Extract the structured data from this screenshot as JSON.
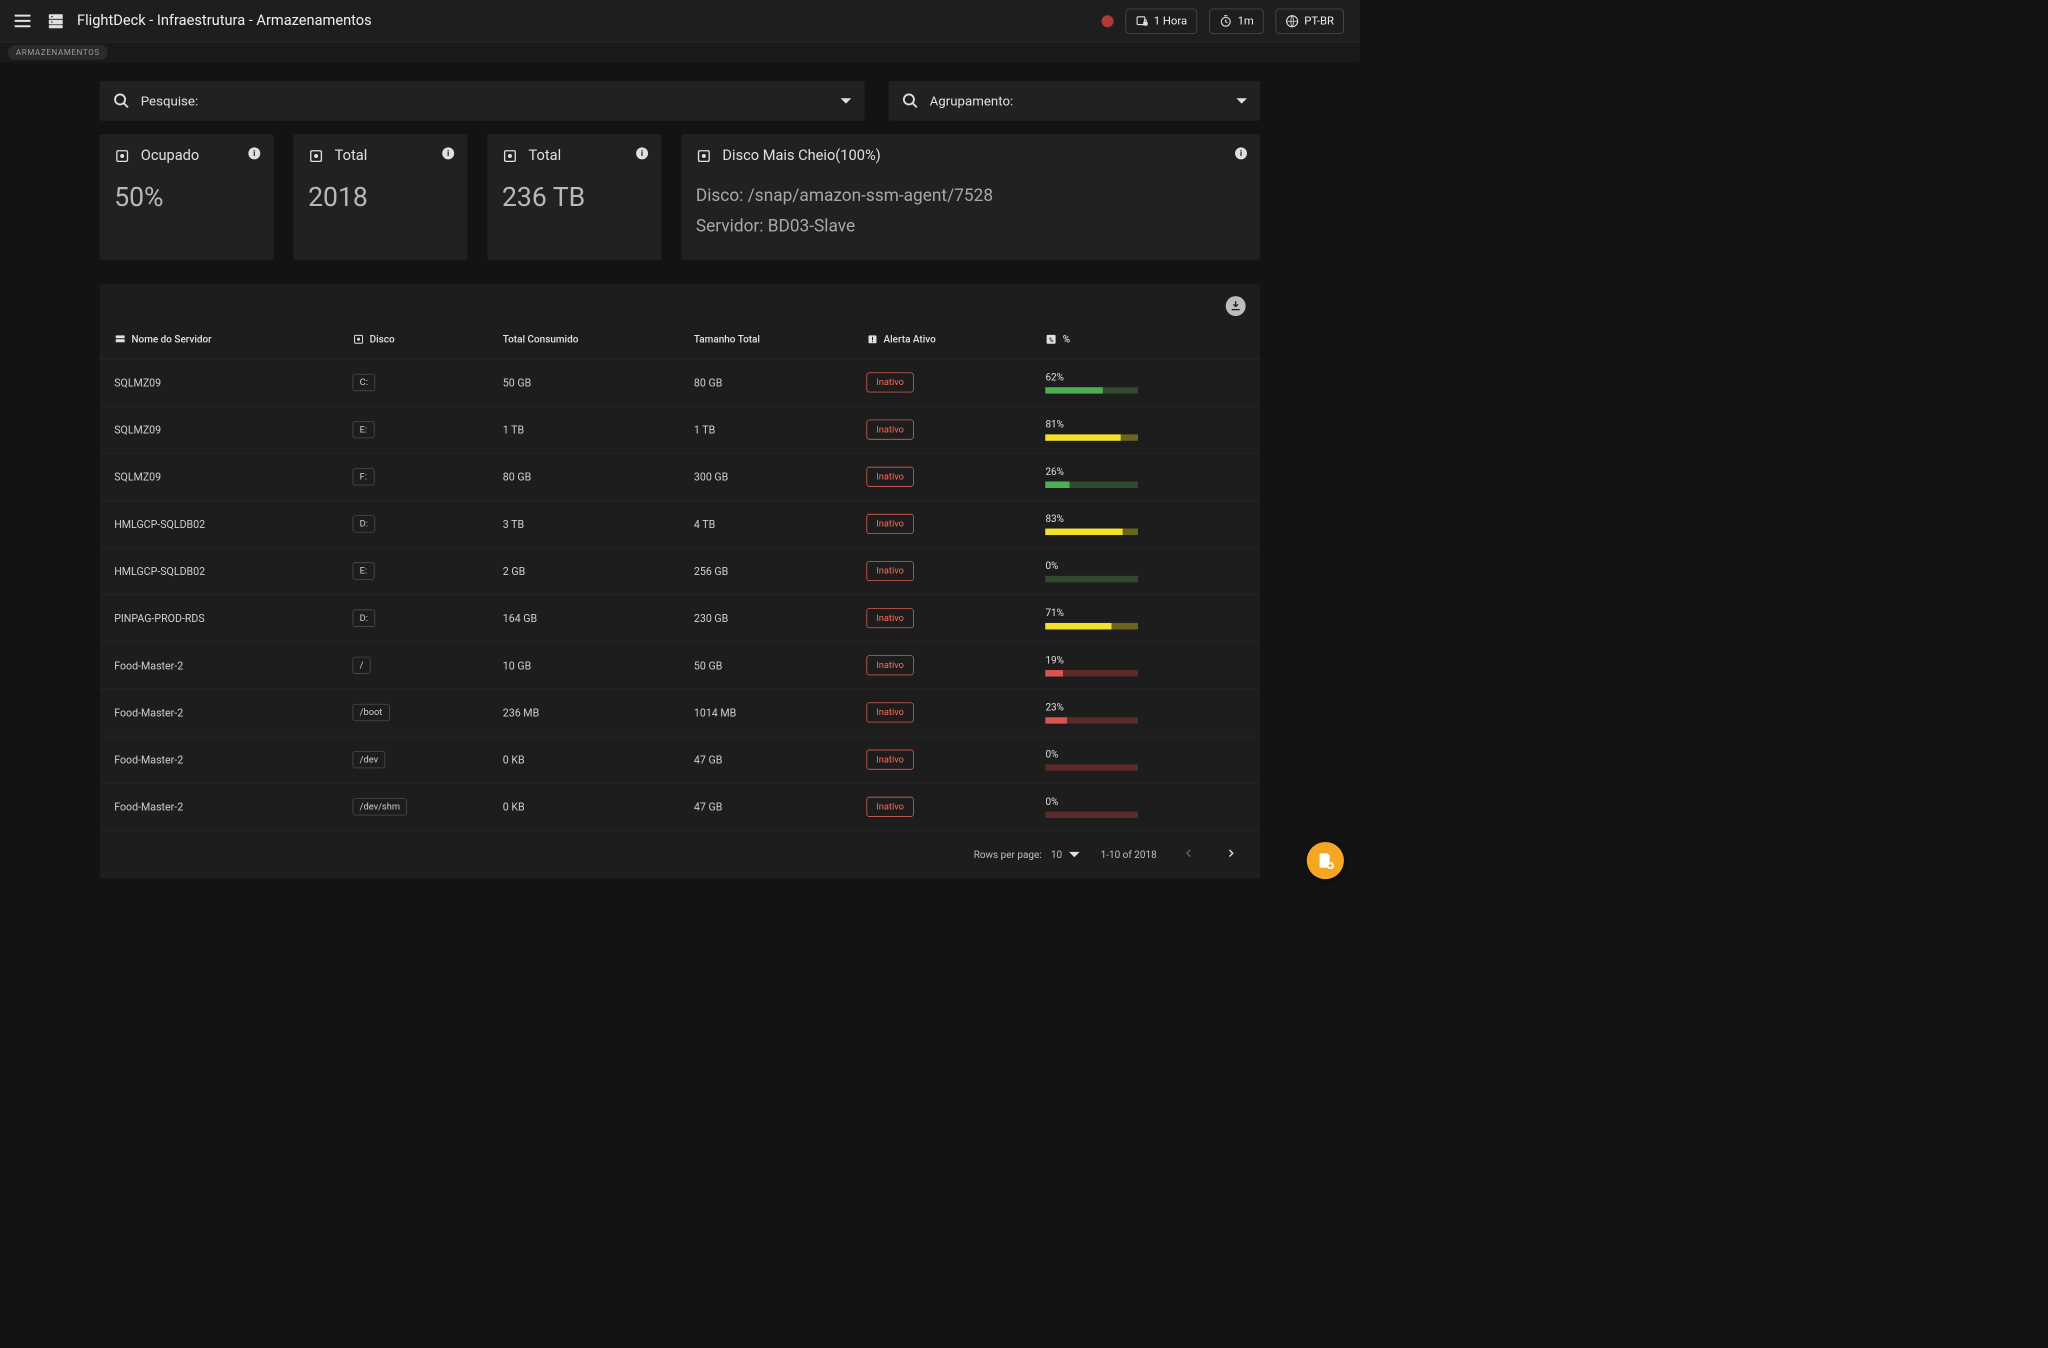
{
  "header": {
    "title": "FlightDeck - Infraestrutura - Armazenamentos",
    "time_range": "1 Hora",
    "refresh": "1m",
    "locale": "PT-BR"
  },
  "breadcrumb": {
    "chip": "ARMAZENAMENTOS"
  },
  "search": {
    "placeholder": "Pesquise:",
    "group_placeholder": "Agrupamento:"
  },
  "cards": {
    "occupied": {
      "label": "Ocupado",
      "value": "50%"
    },
    "total_count": {
      "label": "Total",
      "value": "2018"
    },
    "total_size": {
      "label": "Total",
      "value": "236 TB"
    },
    "fullest": {
      "label": "Disco Mais Cheio(100%)",
      "line1": "Disco: /snap/amazon-ssm-agent/7528",
      "line2": "Servidor: BD03-Slave"
    }
  },
  "columns": {
    "server": "Nome do Servidor",
    "disk": "Disco",
    "consumed": "Total Consumido",
    "total": "Tamanho Total",
    "alert": "Alerta Ativo",
    "pct": "%"
  },
  "rows": [
    {
      "server": "SQLMZ09",
      "disk": "C:",
      "consumed": "50 GB",
      "total": "80 GB",
      "alert": "Inativo",
      "pct_label": "62%",
      "pct": 62,
      "fill": "#4caf50",
      "rest": "#2f4a2f"
    },
    {
      "server": "SQLMZ09",
      "disk": "E:",
      "consumed": "1 TB",
      "total": "1 TB",
      "alert": "Inativo",
      "pct_label": "81%",
      "pct": 81,
      "fill": "#f2e12a",
      "rest": "#6a6420"
    },
    {
      "server": "SQLMZ09",
      "disk": "F:",
      "consumed": "80 GB",
      "total": "300 GB",
      "alert": "Inativo",
      "pct_label": "26%",
      "pct": 26,
      "fill": "#4caf50",
      "rest": "#2f4a2f"
    },
    {
      "server": "HMLGCP-SQLDB02",
      "disk": "D:",
      "consumed": "3 TB",
      "total": "4 TB",
      "alert": "Inativo",
      "pct_label": "83%",
      "pct": 83,
      "fill": "#f2e12a",
      "rest": "#6a6420"
    },
    {
      "server": "HMLGCP-SQLDB02",
      "disk": "E:",
      "consumed": "2 GB",
      "total": "256 GB",
      "alert": "Inativo",
      "pct_label": "0%",
      "pct": 0,
      "fill": "#4caf50",
      "rest": "#2f4a2f"
    },
    {
      "server": "PINPAG-PROD-RDS",
      "disk": "D:",
      "consumed": "164 GB",
      "total": "230 GB",
      "alert": "Inativo",
      "pct_label": "71%",
      "pct": 71,
      "fill": "#f2e12a",
      "rest": "#6a6420"
    },
    {
      "server": "Food-Master-2",
      "disk": "/",
      "consumed": "10 GB",
      "total": "50 GB",
      "alert": "Inativo",
      "pct_label": "19%",
      "pct": 19,
      "fill": "#d9534f",
      "rest": "#5a2a29"
    },
    {
      "server": "Food-Master-2",
      "disk": "/boot",
      "consumed": "236 MB",
      "total": "1014 MB",
      "alert": "Inativo",
      "pct_label": "23%",
      "pct": 23,
      "fill": "#d9534f",
      "rest": "#5a2a29"
    },
    {
      "server": "Food-Master-2",
      "disk": "/dev",
      "consumed": "0 KB",
      "total": "47 GB",
      "alert": "Inativo",
      "pct_label": "0%",
      "pct": 0,
      "fill": "#d9534f",
      "rest": "#5a2a29"
    },
    {
      "server": "Food-Master-2",
      "disk": "/dev/shm",
      "consumed": "0 KB",
      "total": "47 GB",
      "alert": "Inativo",
      "pct_label": "0%",
      "pct": 0,
      "fill": "#d9534f",
      "rest": "#5a2a29"
    }
  ],
  "pagination": {
    "rows_per_page_label": "Rows per page:",
    "rows_per_page_value": "10",
    "range": "1-10 of 2018"
  }
}
